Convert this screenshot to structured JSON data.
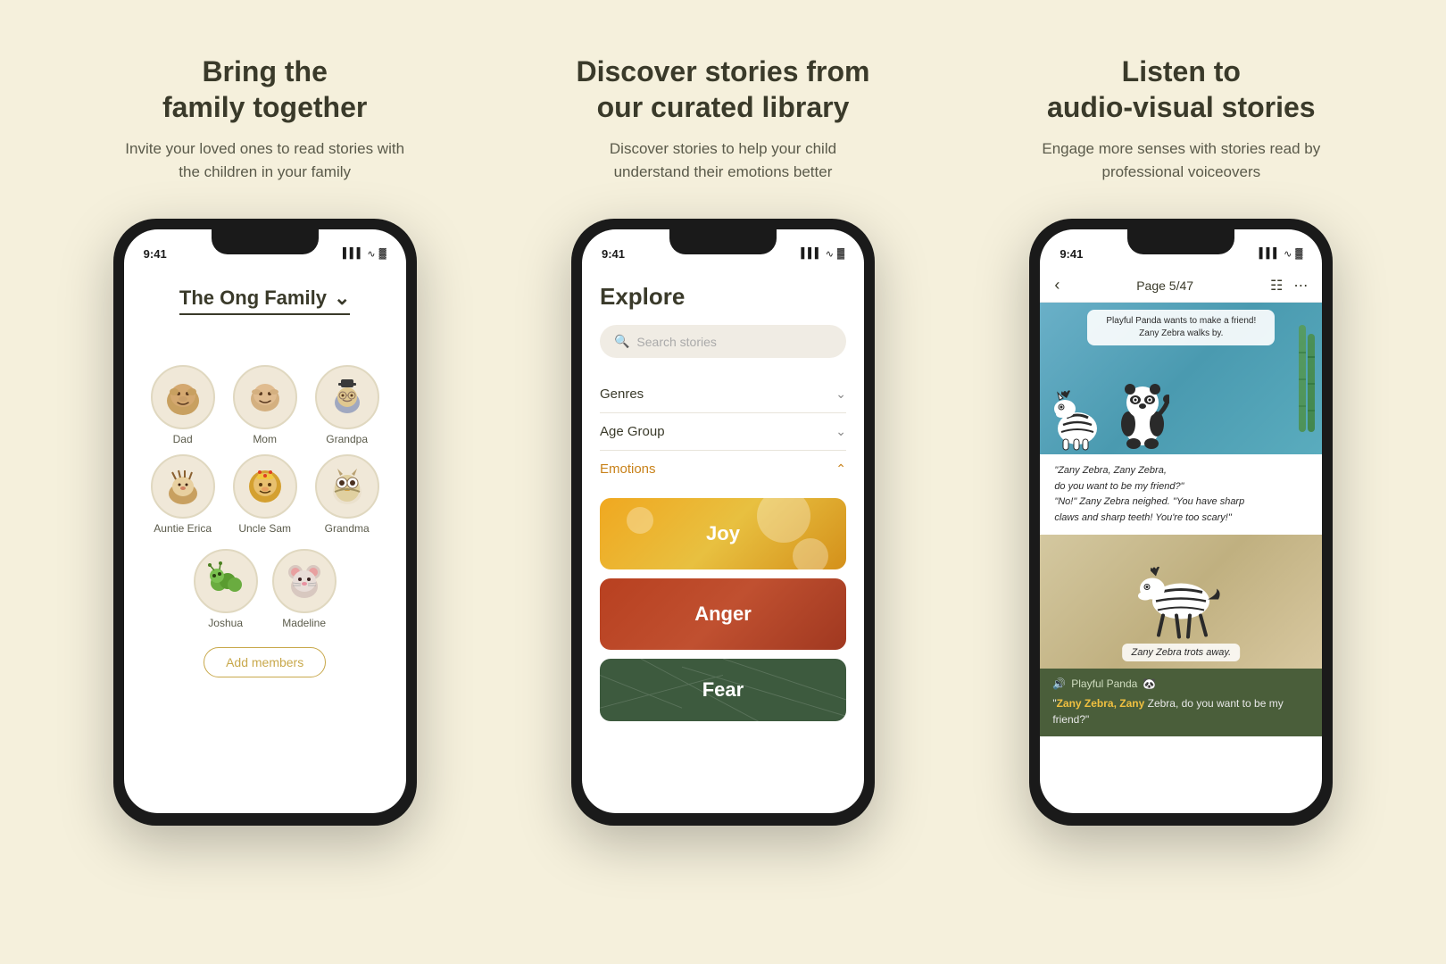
{
  "page": {
    "bg_color": "#f5f0dc"
  },
  "column1": {
    "title": "Bring the\nfamily together",
    "subtitle": "Invite your loved ones to read stories with the children in your family",
    "phone": {
      "status_time": "9:41",
      "family_name": "The Ong Family",
      "members": [
        {
          "name": "Dad",
          "emoji": "🐻"
        },
        {
          "name": "Mom",
          "emoji": "🐻"
        },
        {
          "name": "Grandpa",
          "emoji": "🎩"
        },
        {
          "name": "Auntie Erica",
          "emoji": "🦔"
        },
        {
          "name": "Uncle Sam",
          "emoji": "🦁"
        },
        {
          "name": "Grandma",
          "emoji": "🦉"
        },
        {
          "name": "Joshua",
          "emoji": "🐛"
        },
        {
          "name": "Madeline",
          "emoji": "🐭"
        }
      ],
      "add_button": "Add members"
    }
  },
  "column2": {
    "title": "Discover stories from\nour curated library",
    "subtitle": "Discover stories to help your child understand their emotions better",
    "phone": {
      "status_time": "9:41",
      "explore_title": "Explore",
      "search_placeholder": "Search stories",
      "filters": [
        {
          "label": "Genres",
          "active": false
        },
        {
          "label": "Age Group",
          "active": false
        },
        {
          "label": "Emotions",
          "active": true
        }
      ],
      "emotions": [
        {
          "label": "Joy",
          "style": "joy"
        },
        {
          "label": "Anger",
          "style": "anger"
        },
        {
          "label": "Fear",
          "style": "fear"
        }
      ]
    }
  },
  "column3": {
    "title": "Listen to\naudio-visual stories",
    "subtitle": "Engage more senses with stories read by professional voiceovers",
    "phone": {
      "status_time": "9:41",
      "page_info": "Page 5/47",
      "story_bubble": "Playful Panda wants to make a friend!\nZany Zebra walks by.",
      "dialogue": "\"Zany Zebra, Zany Zebra,\ndo you want to be my friend?\"\n\"No!\" Zany Zebra neighed. \"You have sharp\nclaws and sharp teeth! You're too scary!\"",
      "scene2_text": "Zany Zebra trots away.",
      "audio_title": "Playful Panda",
      "audio_quote_part1": "\"",
      "audio_highlight": "Zany Zebra, Zany",
      "audio_quote_rest": " Zebra, do you want to be my friend?\""
    }
  }
}
